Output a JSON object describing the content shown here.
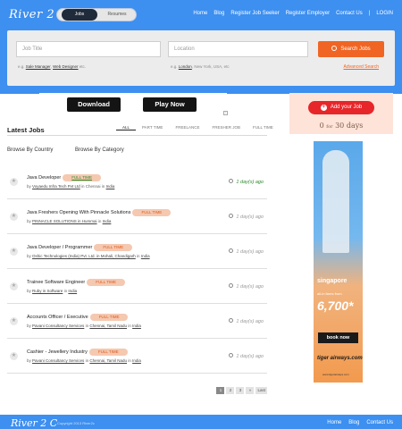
{
  "header": {
    "logo": "River 2 C",
    "toggle": {
      "jobs": "Jobs",
      "resumes": "Resumes"
    },
    "nav": [
      "Home",
      "Blog",
      "Register Job Seeker",
      "Register Employer",
      "Contact Us",
      "LOGIN"
    ],
    "nav_separator": "|"
  },
  "search": {
    "job_title_placeholder": "Job Title",
    "location_placeholder": "Location",
    "button_label": "Search Jobs",
    "hint1_prefix": "e.g.",
    "hint1_link1": "Sale Manager",
    "hint1_sep": ",",
    "hint1_link2": "Web Designer",
    "hint1_suffix": "etc.",
    "hint2_prefix": "e.g.",
    "hint2_link1": "London",
    "hint2_rest": ", New York, USA, etc",
    "advanced_label": "Advanced Search"
  },
  "ad_top": {
    "download": "Download",
    "play_now": "Play Now",
    "ad_flag": "i"
  },
  "jobs_section": {
    "heading": "Latest Jobs",
    "tabs": [
      "ALL",
      "PART TIME",
      "FREELANCE",
      "FRESHER JOB",
      "FULL TIME"
    ],
    "browse_country": "Browse By Country",
    "browse_category": "Browse By Category",
    "jobs": [
      {
        "title": "Java Developer",
        "badge": "FULL TIME",
        "badge_style": "green",
        "by": "by",
        "company": "Voyaedu Infra Tech Pvt Ltd",
        "mid": "in Chennai",
        "loc_prefix": "in",
        "location": "India",
        "location2": "",
        "time": "1 day(s) ago",
        "new": true
      },
      {
        "title": "Java Freshers Opening With Pinnacle Solutions",
        "badge": "FULL TIME",
        "badge_style": "orange",
        "by": "by",
        "company": "PINNACLE SOLUTIONS in Hummai",
        "mid": "",
        "loc_prefix": "in",
        "location": "India",
        "location2": "",
        "time": "1 day(s) ago",
        "new": false
      },
      {
        "title": "Java Developer / Programmer",
        "badge": "FULL TIME",
        "badge_style": "orange",
        "by": "by",
        "company": "Oshic Technologies (India) Pvt. Ltd. in Mohali, Chandigarh",
        "mid": "",
        "loc_prefix": "in",
        "location": "India",
        "location2": "",
        "time": "1 day(s) ago",
        "new": false
      },
      {
        "title": "Trainee Software Engineer",
        "badge": "FULL TIME",
        "badge_style": "orange",
        "by": "by",
        "company": "Ruby in Software",
        "mid": "",
        "loc_prefix": "in",
        "location": "India",
        "location2": "",
        "time": "1 day(s) ago",
        "new": false
      },
      {
        "title": "Accounts Officer / Executive",
        "badge": "FULL TIME",
        "badge_style": "orange",
        "by": "by",
        "company": "Pavani Consultancy Services",
        "mid": "",
        "loc_prefix": "in",
        "location": "Chennai, Tamil Nadu",
        "location2": "India",
        "time": "1 day(s) ago",
        "new": false
      },
      {
        "title": "Cashier - Jewellery Industry",
        "badge": "FULL TIME",
        "badge_style": "orange",
        "by": "by",
        "company": "Pavani Consultancy Services",
        "mid": "",
        "loc_prefix": "in",
        "location": "Chennai, Tamil Nadu",
        "location2": "India",
        "time": "1 day(s) ago",
        "new": false
      }
    ],
    "pager": [
      "1",
      "2",
      "3",
      "»",
      "Last"
    ]
  },
  "sidebar": {
    "add_job": "Add your Job",
    "price_prefix": "0",
    "price_for": "for",
    "price_days": "30 days",
    "ad": {
      "destination": "singapore",
      "from": "all-in fares from",
      "price": "6,700*",
      "cta": "book now",
      "brand": "tiger airways.com",
      "url": "www.tigerairways.com"
    }
  },
  "footer": {
    "logo": "River 2 C",
    "copyright": "Copyright 2013 River2c",
    "nav": [
      "Home",
      "Blog",
      "Contact Us"
    ]
  },
  "colors": {
    "brand_blue": "#3d8ff0",
    "accent_orange": "#f06524",
    "add_red": "#e7262a"
  }
}
